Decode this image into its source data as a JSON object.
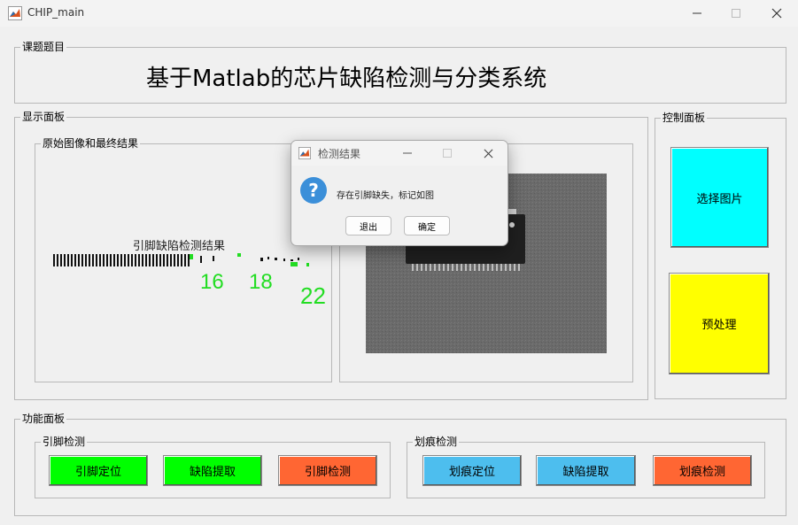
{
  "window": {
    "title": "CHIP_main",
    "minimize_icon": "minimize-icon",
    "maximize_icon": "maximize-icon",
    "close_icon": "close-icon"
  },
  "title_panel": {
    "legend": "课题题目",
    "title": "基于Matlab的芯片缺陷检测与分类系统"
  },
  "display_panel": {
    "legend": "显示面板",
    "left_panel": {
      "legend": "原始图像和最终结果",
      "result_title": "引脚缺陷检测结果",
      "numbers": [
        "16",
        "18",
        "22"
      ]
    },
    "right_panel": {
      "legend": ""
    }
  },
  "control_panel": {
    "legend": "控制面板",
    "select_image": "选择图片",
    "preprocess": "预处理"
  },
  "function_panel": {
    "legend": "功能面板",
    "pin_group": {
      "legend": "引脚检测",
      "buttons": [
        "引脚定位",
        "缺陷提取",
        "引脚检测"
      ]
    },
    "scratch_group": {
      "legend": "划痕检测",
      "buttons": [
        "划痕定位",
        "缺陷提取",
        "划痕检测"
      ]
    }
  },
  "dialog": {
    "title": "检测结果",
    "message": "存在引脚缺失，标记如图",
    "exit_label": "退出",
    "ok_label": "确定",
    "icon": "question-icon"
  },
  "colors": {
    "green": "#00ff00",
    "orange": "#ff6633",
    "blue": "#4dbeee",
    "cyan": "#00ffff",
    "yellow": "#ffff00"
  }
}
